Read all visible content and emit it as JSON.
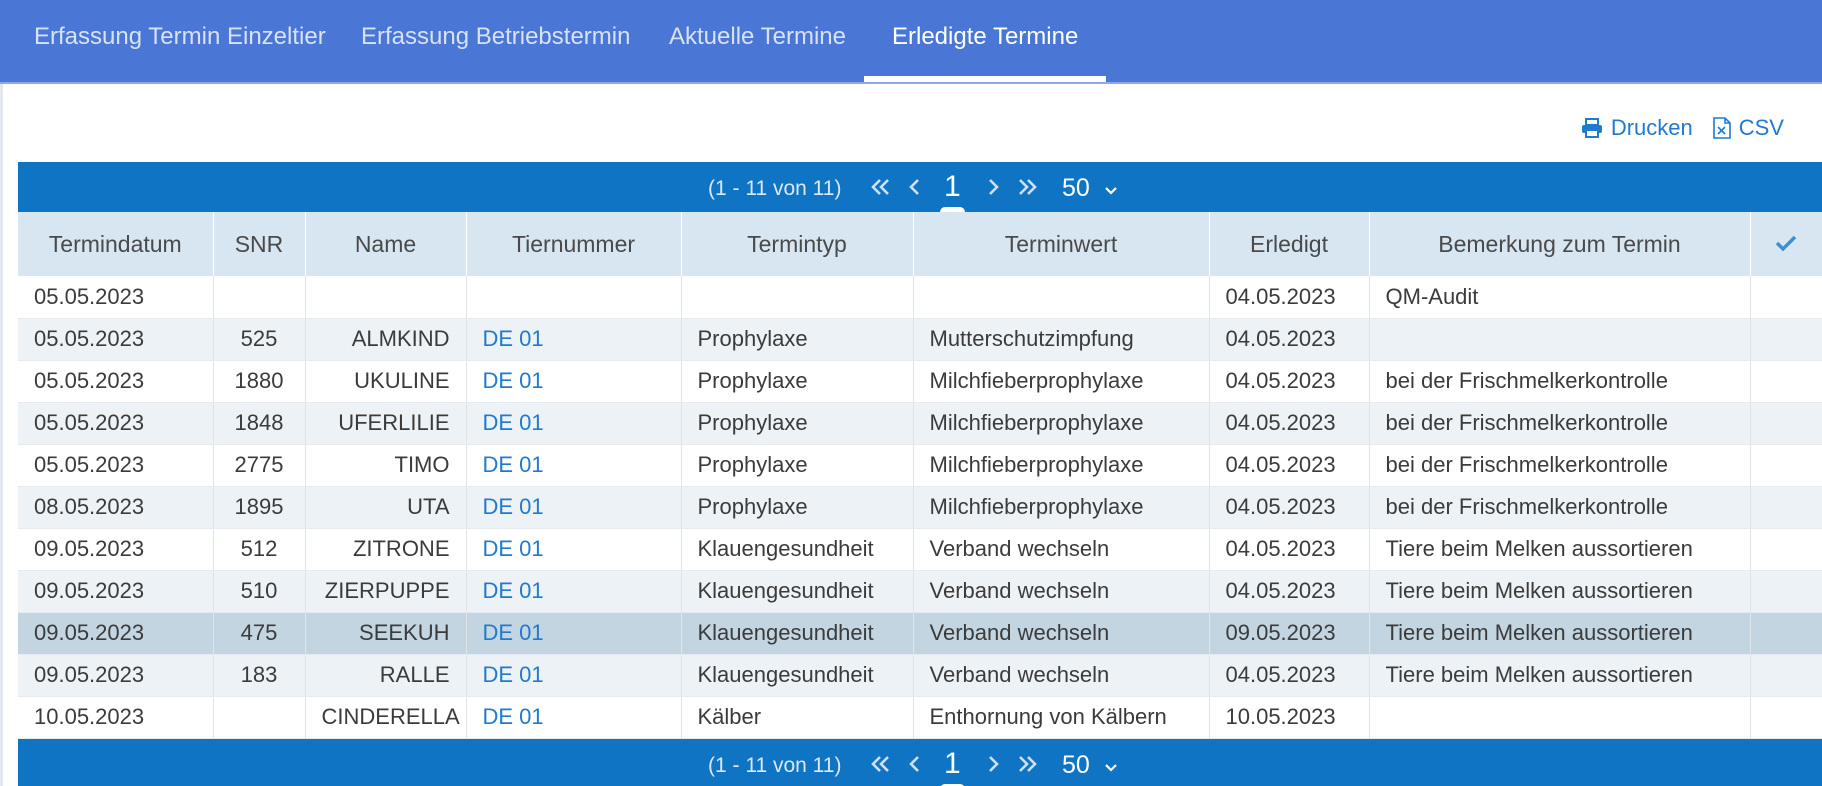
{
  "tabs": [
    {
      "label": "Erfassung Termin Einzeltier",
      "active": false
    },
    {
      "label": "Erfassung Betriebstermin",
      "active": false
    },
    {
      "label": "Aktuelle Termine",
      "active": false
    },
    {
      "label": "Erledigte Termine",
      "active": true
    }
  ],
  "actions": {
    "print_label": "Drucken",
    "csv_label": "CSV"
  },
  "pager": {
    "info": "(1 - 11 von 11)",
    "current_page": "1",
    "page_size": "50"
  },
  "columns": [
    "Termindatum",
    "SNR",
    "Name",
    "Tiernummer",
    "Termintyp",
    "Terminwert",
    "Erledigt",
    "Bemerkung zum Termin"
  ],
  "check_header_icon": "check-icon",
  "rows": [
    {
      "termindatum": "05.05.2023",
      "snr": "",
      "name": "",
      "tiernummer": "",
      "termintyp": "",
      "terminwert": "",
      "erledigt": "04.05.2023",
      "bemerkung": "QM-Audit"
    },
    {
      "termindatum": "05.05.2023",
      "snr": "525",
      "name": "ALMKIND",
      "tiernummer": "DE 01",
      "termintyp": "Prophylaxe",
      "terminwert": "Mutterschutzimpfung",
      "erledigt": "04.05.2023",
      "bemerkung": ""
    },
    {
      "termindatum": "05.05.2023",
      "snr": "1880",
      "name": "UKULINE",
      "tiernummer": "DE 01",
      "termintyp": "Prophylaxe",
      "terminwert": "Milchfieberprophylaxe",
      "erledigt": "04.05.2023",
      "bemerkung": "bei der Frischmelkerkontrolle"
    },
    {
      "termindatum": "05.05.2023",
      "snr": "1848",
      "name": "UFERLILIE",
      "tiernummer": "DE 01",
      "termintyp": "Prophylaxe",
      "terminwert": "Milchfieberprophylaxe",
      "erledigt": "04.05.2023",
      "bemerkung": "bei der Frischmelkerkontrolle"
    },
    {
      "termindatum": "05.05.2023",
      "snr": "2775",
      "name": "TIMO",
      "tiernummer": "DE 01",
      "termintyp": "Prophylaxe",
      "terminwert": "Milchfieberprophylaxe",
      "erledigt": "04.05.2023",
      "bemerkung": "bei der Frischmelkerkontrolle"
    },
    {
      "termindatum": "08.05.2023",
      "snr": "1895",
      "name": "UTA",
      "tiernummer": "DE 01",
      "termintyp": "Prophylaxe",
      "terminwert": "Milchfieberprophylaxe",
      "erledigt": "04.05.2023",
      "bemerkung": "bei der Frischmelkerkontrolle"
    },
    {
      "termindatum": "09.05.2023",
      "snr": "512",
      "name": "ZITRONE",
      "tiernummer": "DE 01",
      "termintyp": "Klauengesundheit",
      "terminwert": "Verband wechseln",
      "erledigt": "04.05.2023",
      "bemerkung": "Tiere beim Melken aussortieren"
    },
    {
      "termindatum": "09.05.2023",
      "snr": "510",
      "name": "ZIERPUPPE",
      "tiernummer": "DE 01",
      "termintyp": "Klauengesundheit",
      "terminwert": "Verband wechseln",
      "erledigt": "04.05.2023",
      "bemerkung": "Tiere beim Melken aussortieren"
    },
    {
      "termindatum": "09.05.2023",
      "snr": "475",
      "name": "SEEKUH",
      "tiernummer": "DE 01",
      "termintyp": "Klauengesundheit",
      "terminwert": "Verband wechseln",
      "erledigt": "09.05.2023",
      "bemerkung": "Tiere beim Melken aussortieren",
      "selected": true
    },
    {
      "termindatum": "09.05.2023",
      "snr": "183",
      "name": "RALLE",
      "tiernummer": "DE 01",
      "termintyp": "Klauengesundheit",
      "terminwert": "Verband wechseln",
      "erledigt": "04.05.2023",
      "bemerkung": "Tiere beim Melken aussortieren"
    },
    {
      "termindatum": "10.05.2023",
      "snr": "",
      "name": "CINDERELLA",
      "tiernummer": "DE 01",
      "termintyp": "Kälber",
      "terminwert": "Enthornung von Kälbern",
      "erledigt": "10.05.2023",
      "bemerkung": ""
    }
  ]
}
